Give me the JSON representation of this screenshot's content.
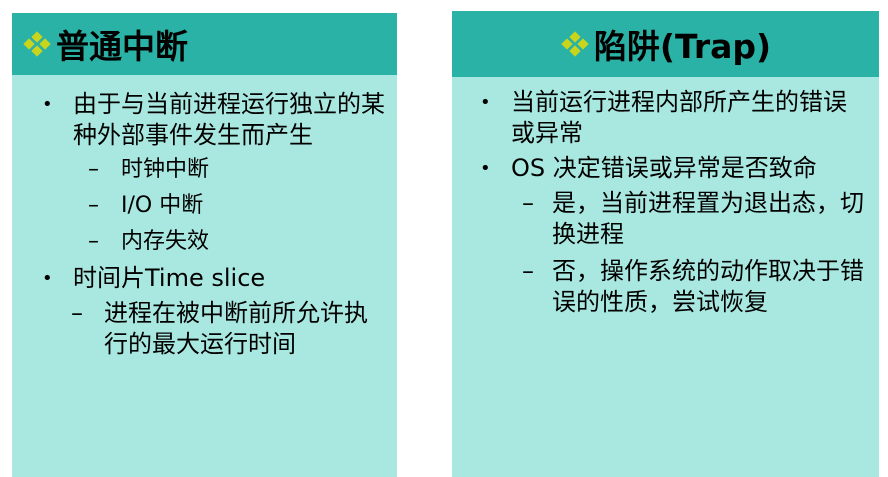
{
  "left": {
    "title": "普通中断",
    "items": [
      {
        "text": "由于与当前进程运行独立的某种外部事件发生而产生"
      },
      {
        "sub": [
          "时钟中断",
          "I/O 中断",
          "内存失效"
        ]
      },
      {
        "text": "时间片Time slice"
      },
      {
        "sub_wide": "进程在被中断前所允许执行的最大运行时间"
      }
    ],
    "bullet": "•",
    "dash": "–"
  },
  "right": {
    "title": "陷阱(Trap)",
    "item1": "当前运行进程内部所产生的错误或异常",
    "item2": "OS 决定错误或异常是否致命",
    "sub1": "是，当前进程置为退出态，切换进程",
    "sub2": "否，操作系统的动作取决于错误的性质，尝试恢复"
  },
  "colors": {
    "header": "#2ab2a6",
    "body": "#a9e8e0",
    "diamond": "#c8d51a"
  },
  "icons": {
    "header_icon": "diamond-cluster-icon"
  }
}
